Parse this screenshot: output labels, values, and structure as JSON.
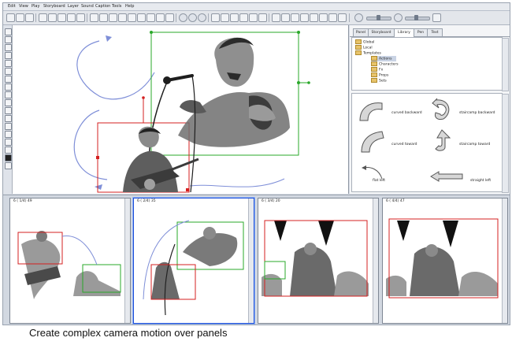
{
  "menu": [
    "Edit",
    "View",
    "Play",
    "Storyboard",
    "Layer",
    "Sound",
    "Caption",
    "Tools",
    "Help"
  ],
  "right_tabs": [
    "Panel",
    "Storyboard",
    "Library",
    "Pen",
    "Text"
  ],
  "active_tab": "Library",
  "tree": {
    "items": [
      {
        "label": "Global",
        "indent": 0
      },
      {
        "label": "Local",
        "indent": 0
      },
      {
        "label": "Templates",
        "indent": 0
      },
      {
        "label": "Actions",
        "indent": 1,
        "selected": true
      },
      {
        "label": "Characters",
        "indent": 1
      },
      {
        "label": "Fx",
        "indent": 1
      },
      {
        "label": "Props",
        "indent": 1
      },
      {
        "label": "Sets",
        "indent": 1
      }
    ]
  },
  "library": {
    "items": [
      "curved backward",
      "staircamp backward",
      "curved toward",
      "staircamp toward",
      "flat left",
      "straight left"
    ]
  },
  "panels": [
    {
      "label": "6 ( 1/4) 49"
    },
    {
      "label": "6 ( 2/4) 35"
    },
    {
      "label": "6 ( 3/4) 20"
    },
    {
      "label": "6 ( 4/4) 47"
    }
  ],
  "caption": "Create complex camera motion over panels",
  "colors": {
    "accent_red": "#d42020",
    "accent_green": "#2aa82a",
    "path_blue": "#7f8fd8",
    "selection_blue": "#1d4ed8"
  }
}
